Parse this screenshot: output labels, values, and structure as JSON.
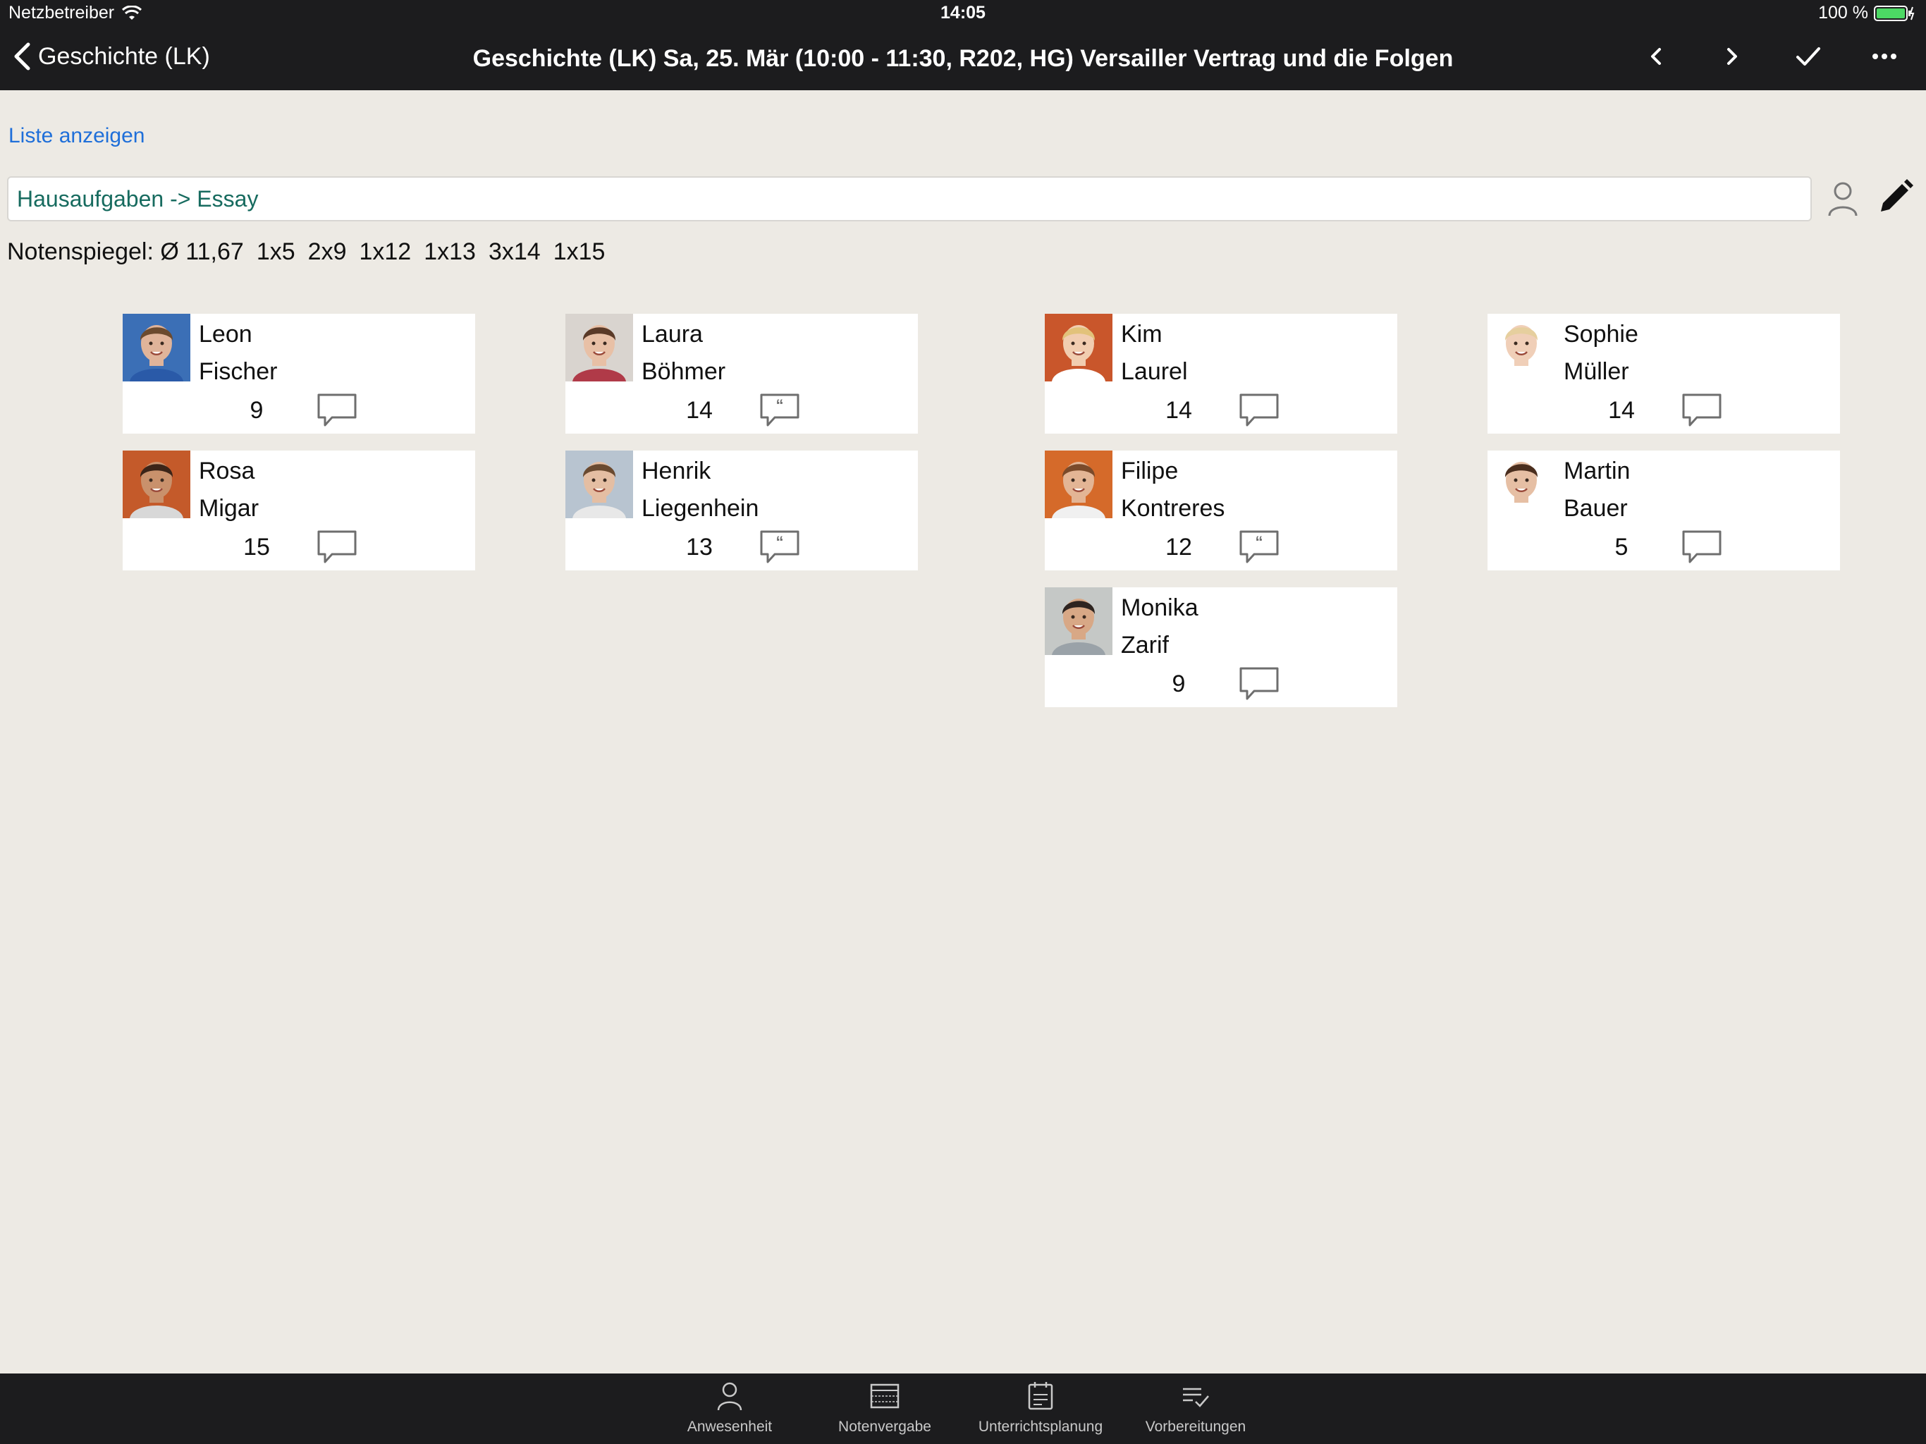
{
  "status_bar": {
    "carrier": "Netzbetreiber",
    "time": "14:05",
    "battery": "100 %"
  },
  "nav": {
    "back_label": "Geschichte (LK)",
    "title": "Geschichte (LK) Sa, 25. Mär (10:00 - 11:30, R202, HG) Versailler Vertrag und die Folgen"
  },
  "content": {
    "show_list_link": "Liste anzeigen",
    "assignment_value": "Hausaufgaben -> Essay",
    "grade_distribution": {
      "prefix": "Notenspiegel: Ø 11,67",
      "counts": [
        "1x5",
        "2x9",
        "1x12",
        "1x13",
        "3x14",
        "1x15"
      ]
    }
  },
  "students": [
    {
      "first": "Leon",
      "last": "Fischer",
      "grade": "9",
      "has_comment": false,
      "skin": "#e0b49a",
      "hair": "#6b4a2e",
      "bg": "#3b6fb6",
      "shirt": "#2a5aa8"
    },
    {
      "first": "Laura",
      "last": "Böhmer",
      "grade": "14",
      "has_comment": true,
      "skin": "#e8c0a6",
      "hair": "#5a3a28",
      "bg": "#d9d4cf",
      "shirt": "#b03a48"
    },
    {
      "first": "Kim",
      "last": "Laurel",
      "grade": "14",
      "has_comment": false,
      "skin": "#f1cdb0",
      "hair": "#e2c27a",
      "bg": "#c9562b",
      "shirt": "#ffffff"
    },
    {
      "first": "Sophie",
      "last": "Müller",
      "grade": "14",
      "has_comment": false,
      "skin": "#f0cfb8",
      "hair": "#e6cf9e",
      "bg": "#ffffff",
      "shirt": "#ffffff"
    },
    {
      "first": "Rosa",
      "last": "Migar",
      "grade": "15",
      "has_comment": false,
      "skin": "#c9916c",
      "hair": "#3b2418",
      "bg": "#c45a2a",
      "shirt": "#d8d8d8"
    },
    {
      "first": "Henrik",
      "last": "Liegenhein",
      "grade": "13",
      "has_comment": true,
      "skin": "#e4bea3",
      "hair": "#6a4a30",
      "bg": "#b8c4d0",
      "shirt": "#e8e8e8"
    },
    {
      "first": "Filipe",
      "last": "Kontreres",
      "grade": "12",
      "has_comment": true,
      "skin": "#e3b595",
      "hair": "#7a4a2a",
      "bg": "#d56a2a",
      "shirt": "#f0f0f0"
    },
    {
      "first": "Martin",
      "last": "Bauer",
      "grade": "5",
      "has_comment": false,
      "skin": "#e6bfa4",
      "hair": "#4a2e1e",
      "bg": "#ffffff",
      "shirt": "#ffffff"
    },
    {
      "first": "Monika",
      "last": "Zarif",
      "grade": "9",
      "has_comment": false,
      "skin": "#d8a886",
      "hair": "#2e2420",
      "bg": "#c5c8c6",
      "shirt": "#9aa2a8"
    }
  ],
  "tabs": [
    {
      "label": "Anwesenheit",
      "icon": "person-icon"
    },
    {
      "label": "Notenvergabe",
      "icon": "grade-grid-icon"
    },
    {
      "label": "Unterrichtsplanung",
      "icon": "planning-icon"
    },
    {
      "label": "Vorbereitungen",
      "icon": "checklist-icon"
    }
  ],
  "colors": {
    "background": "#edeae4",
    "bar": "#1c1c1e",
    "link": "#1f6fd9",
    "assignment_text": "#176b5f",
    "battery_green": "#4cd964"
  }
}
